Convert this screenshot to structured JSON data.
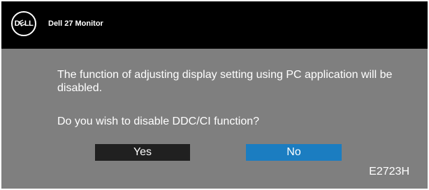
{
  "header": {
    "logo_text": "DELL",
    "title": "Dell 27 Monitor"
  },
  "dialog": {
    "message": "The function of adjusting display setting using PC application will be disabled.",
    "question": "Do you wish to disable DDC/CI function?"
  },
  "buttons": {
    "yes_label": "Yes",
    "no_label": "No",
    "selected": "No"
  },
  "footer": {
    "model": "E2723H"
  },
  "colors": {
    "header_bg": "#000000",
    "body_bg": "#7f7f7f",
    "yes_bg": "#202020",
    "no_selected_bg": "#1b7dc1",
    "text": "#ffffff"
  }
}
